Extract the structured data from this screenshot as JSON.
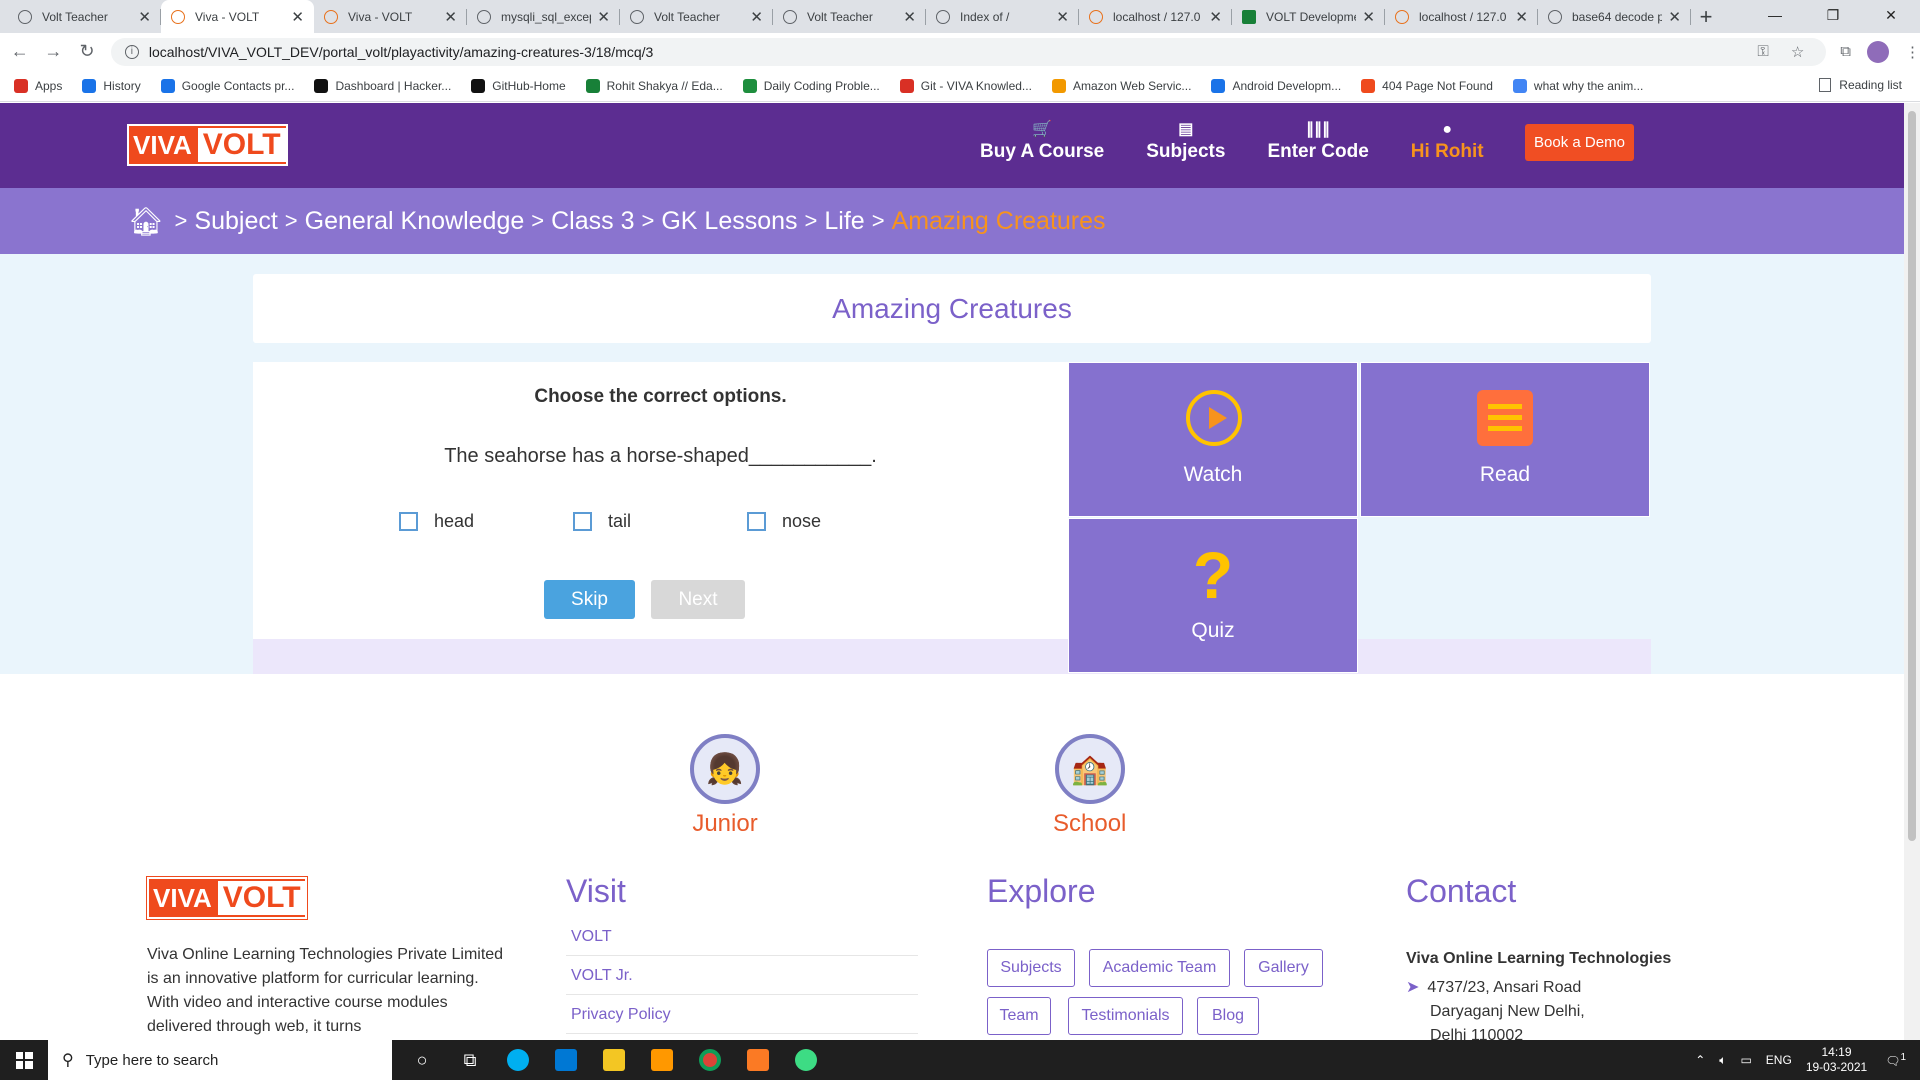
{
  "browser": {
    "tabs": [
      {
        "title": "Volt Teacher",
        "icon": "globe-icon",
        "active": false
      },
      {
        "title": "Viva - VOLT",
        "icon": "volt-favicon-icon",
        "active": true
      },
      {
        "title": "Viva - VOLT",
        "icon": "volt-favicon-icon",
        "active": false
      },
      {
        "title": "mysqli_sql_excep",
        "icon": "globe-icon",
        "active": false
      },
      {
        "title": "Volt Teacher",
        "icon": "globe-icon",
        "active": false
      },
      {
        "title": "Volt Teacher",
        "icon": "globe-icon",
        "active": false
      },
      {
        "title": "Index of /",
        "icon": "globe-icon",
        "active": false
      },
      {
        "title": "localhost / 127.0",
        "icon": "phpmyadmin-icon",
        "active": false
      },
      {
        "title": "VOLT Developme",
        "icon": "sheets-icon",
        "active": false
      },
      {
        "title": "localhost / 127.0",
        "icon": "phpmyadmin-icon",
        "active": false
      },
      {
        "title": "base64 decode p",
        "icon": "google-icon",
        "active": false
      }
    ],
    "new_tab": "+",
    "url": "localhost/VIVA_VOLT_DEV/portal_volt/playactivity/amazing-creatures-3/18/mcq/3",
    "bookmarks": [
      {
        "label": "Apps",
        "color": "#d93025"
      },
      {
        "label": "History",
        "color": "#1a73e8"
      },
      {
        "label": "Google Contacts pr...",
        "color": "#1a73e8"
      },
      {
        "label": "Dashboard | Hacker...",
        "color": "#111111"
      },
      {
        "label": "GitHub-Home",
        "color": "#111111"
      },
      {
        "label": "Rohit Shakya // Eda...",
        "color": "#188038"
      },
      {
        "label": "Daily Coding Proble...",
        "color": "#1e8e3e"
      },
      {
        "label": "Git - VIVA Knowled...",
        "color": "#d93025"
      },
      {
        "label": "Amazon Web Servic...",
        "color": "#f29900"
      },
      {
        "label": "Android Developm...",
        "color": "#1a73e8"
      },
      {
        "label": "404 Page Not Found",
        "color": "#ef4a1d"
      },
      {
        "label": "what why the anim...",
        "color": "#4285f4"
      }
    ],
    "reading_list": "Reading list"
  },
  "site": {
    "logo_viva": "VIVA",
    "logo_volt": "VOLT",
    "nav": [
      {
        "label": "Buy A Course",
        "icon": "🛒",
        "icon_name": "cart-icon"
      },
      {
        "label": "Subjects",
        "icon": "▤",
        "icon_name": "books-icon"
      },
      {
        "label": "Enter Code",
        "icon": "∥∥∥",
        "icon_name": "barcode-icon"
      },
      {
        "label": "Hi Rohit",
        "icon": "●",
        "icon_name": "user-icon"
      }
    ],
    "demo_button": "Book a Demo",
    "breadcrumb": [
      "Subject",
      "General Knowledge",
      "Class 3",
      "GK Lessons",
      "Life",
      "Amazing Creatures"
    ],
    "page_title": "Amazing Creatures"
  },
  "quiz": {
    "heading": "Choose the correct options.",
    "question": "The seahorse has a horse-shaped___________.",
    "options": [
      "head",
      "tail",
      "nose"
    ],
    "skip_label": "Skip",
    "next_label": "Next"
  },
  "activities": {
    "watch": "Watch",
    "read": "Read",
    "quiz": "Quiz",
    "quiz_symbol": "?"
  },
  "footer": {
    "categories": [
      {
        "label": "Junior",
        "icon": "👧"
      },
      {
        "label": "School",
        "icon": "🏫"
      }
    ],
    "about": "Viva Online Learning Technologies Private Limited is an innovative platform for curricular learning. With video and interactive course modules delivered through web, it turns",
    "visit_heading": "Visit",
    "visit_links": [
      "VOLT",
      "VOLT Jr.",
      "Privacy Policy"
    ],
    "explore_heading": "Explore",
    "explore_tags": [
      "Subjects",
      "Academic Team",
      "Gallery",
      "Team",
      "Testimonials",
      "Blog"
    ],
    "contact_heading": "Contact",
    "contact_name": "Viva Online Learning Technologies",
    "contact_line1": "4737/23, Ansari Road",
    "contact_line2": "Daryaganj New Delhi,",
    "contact_line3": "Delhi 110002"
  },
  "taskbar": {
    "search_placeholder": "Type here to search",
    "language": "ENG",
    "time": "14:19",
    "date": "19-03-2021",
    "notifications": "1"
  },
  "colors": {
    "header_purple": "#5c2d91",
    "breadcrumb_purple": "#8a74cf",
    "accent_orange": "#f7931d",
    "logo_red": "#ef4a1d",
    "tile_purple": "#8571cf",
    "skip_blue": "#4aa3df"
  }
}
